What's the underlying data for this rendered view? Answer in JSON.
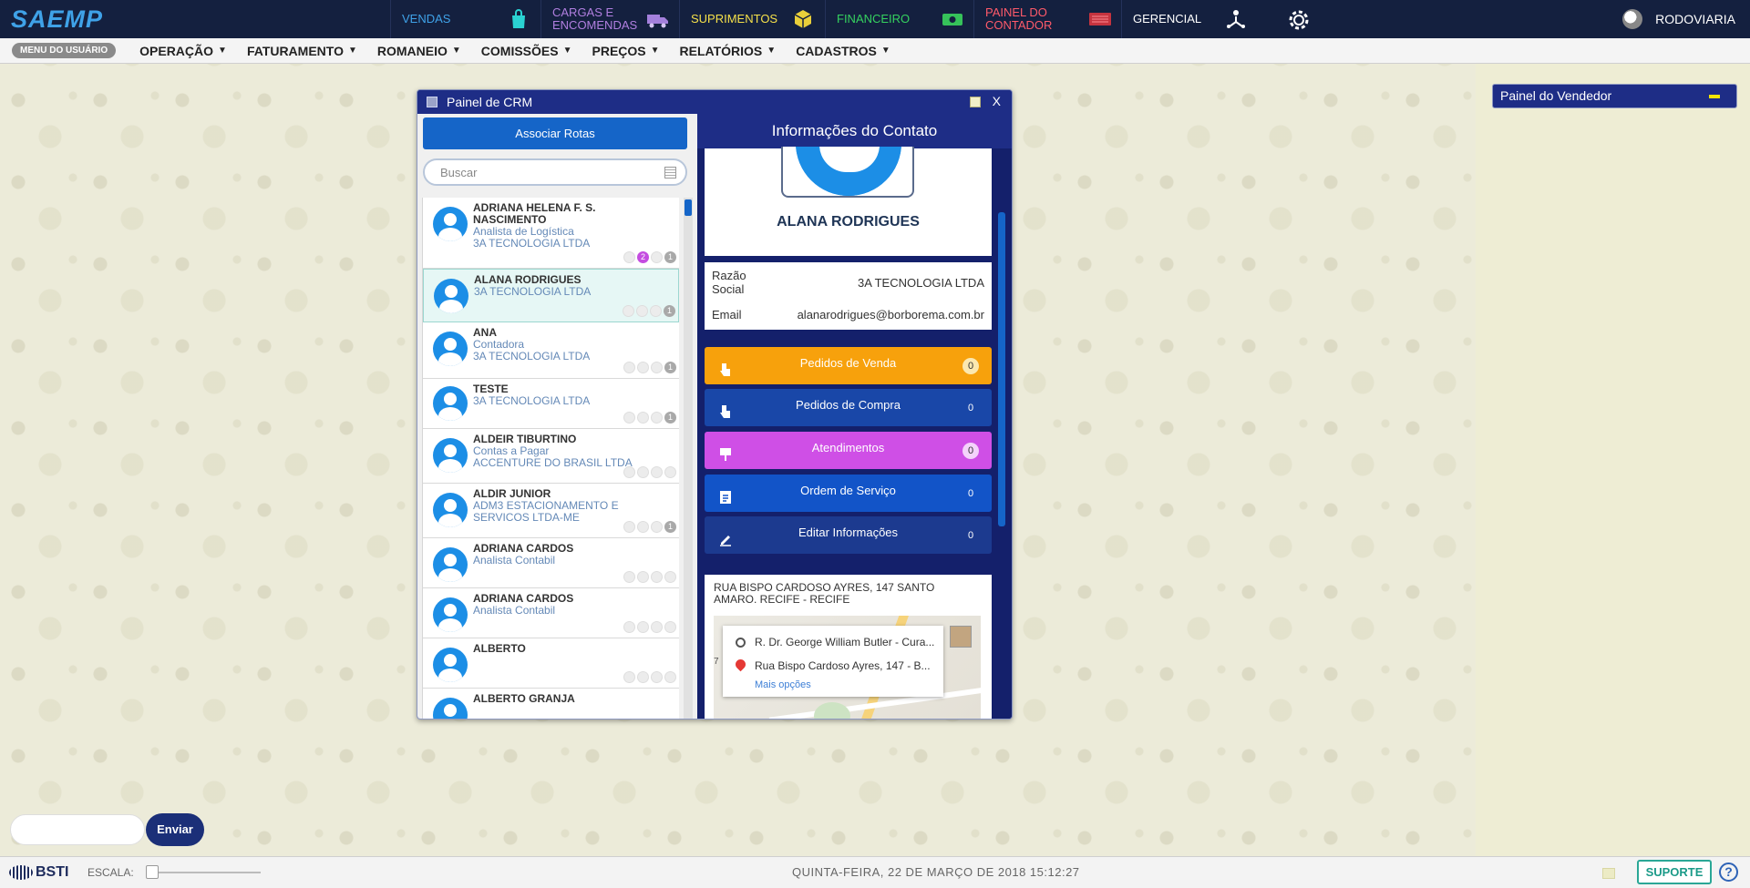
{
  "topbar": {
    "logo": "SAEMP",
    "modules": [
      {
        "label": "VENDAS",
        "color": "#3fa2e8"
      },
      {
        "label": "CARGAS E ENCOMENDAS",
        "color": "#b17fe0"
      },
      {
        "label": "SUPRIMENTOS",
        "color": "#f5e04a"
      },
      {
        "label": "FINANCEIRO",
        "color": "#35d15f"
      },
      {
        "label": "PAINEL DO CONTADOR",
        "color": "#ff5a6a"
      },
      {
        "label": "GERENCIAL",
        "color": "#ffffff"
      }
    ],
    "user": "RODOVIARIA"
  },
  "menubar": {
    "user_menu": "MENU DO USUÁRIO",
    "items": [
      "OPERAÇÃO",
      "FATURAMENTO",
      "ROMANEIO",
      "COMISSÕES",
      "PREÇOS",
      "RELATÓRIOS",
      "CADASTROS"
    ]
  },
  "crm": {
    "title": "Painel de CRM",
    "close": "X",
    "associate_button": "Associar Rotas",
    "search_placeholder": "Buscar",
    "contacts": [
      {
        "name": "ADRIANA HELENA F. S. NASCIMENTO",
        "role": "Analista de Logística",
        "company": "3A TECNOLOGIA LTDA",
        "badge_pink": "2",
        "badge_gray": "1"
      },
      {
        "name": "ALANA RODRIGUES",
        "role": "",
        "company": "3A TECNOLOGIA LTDA",
        "badge_pink": "",
        "badge_gray": "1"
      },
      {
        "name": "ANA",
        "role": "Contadora",
        "company": "3A TECNOLOGIA LTDA",
        "badge_pink": "",
        "badge_gray": "1"
      },
      {
        "name": "TESTE",
        "role": "",
        "company": "3A TECNOLOGIA LTDA",
        "badge_pink": "",
        "badge_gray": "1"
      },
      {
        "name": "ALDEIR TIBURTINO",
        "role": "Contas a Pagar",
        "company": "ACCENTURE DO BRASIL LTDA",
        "badge_pink": "",
        "badge_gray": ""
      },
      {
        "name": "ALDIR JUNIOR",
        "role": "",
        "company": "ADM3 ESTACIONAMENTO E SERVICOS LTDA-ME",
        "badge_pink": "",
        "badge_gray": "1"
      },
      {
        "name": "ADRIANA CARDOS",
        "role": "Analista Contabil",
        "company": "",
        "badge_pink": "",
        "badge_gray": ""
      },
      {
        "name": "ADRIANA CARDOS",
        "role": "Analista Contabil",
        "company": "",
        "badge_pink": "",
        "badge_gray": ""
      },
      {
        "name": "ALBERTO",
        "role": "",
        "company": "",
        "badge_pink": "",
        "badge_gray": ""
      },
      {
        "name": "ALBERTO GRANJA",
        "role": "",
        "company": "",
        "badge_pink": "",
        "badge_gray": ""
      }
    ],
    "info": {
      "title": "Informações do Contato",
      "name": "ALANA RODRIGUES",
      "razao_label": "Razão Social",
      "razao_value": "3A TECNOLOGIA LTDA",
      "email_label": "Email",
      "email_value": "alanarodrigues@borborema.com.br",
      "actions": [
        {
          "label": "Pedidos de Venda",
          "count": "0",
          "color": "#f7a10c",
          "count_bg": "#fbe8b0",
          "count_color": "#333"
        },
        {
          "label": "Pedidos de Compra",
          "count": "0",
          "color": "#1947a8",
          "count_bg": "#1947a8",
          "count_color": "#fff"
        },
        {
          "label": "Atendimentos",
          "count": "0",
          "color": "#cf4fe6",
          "count_bg": "#f4d2fb",
          "count_color": "#333"
        },
        {
          "label": "Ordem de Serviço",
          "count": "0",
          "color": "#1254c8",
          "count_bg": "#1254c8",
          "count_color": "#fff"
        },
        {
          "label": "Editar Informações",
          "count": "0",
          "color": "#1c3a8f",
          "count_bg": "#1c3a8f",
          "count_color": "#fff"
        }
      ],
      "address": "RUA BISPO CARDOSO AYRES, 147 SANTO AMARO. RECIFE - RECIFE",
      "map_origin": "R. Dr. George William Butler - Cura...",
      "map_destination": "Rua Bispo Cardoso Ayres, 147 - B...",
      "map_more": "Mais opções",
      "map_edge_letter": "7"
    }
  },
  "vendor_panel": {
    "title": "Painel do Vendedor"
  },
  "chat": {
    "send": "Enviar"
  },
  "statusbar": {
    "brand": "BSTI",
    "scale_label": "ESCALA:",
    "datetime": "QUINTA-FEIRA, 22 DE MARÇO DE 2018 15:12:27",
    "support": "SUPORTE",
    "help": "?"
  }
}
